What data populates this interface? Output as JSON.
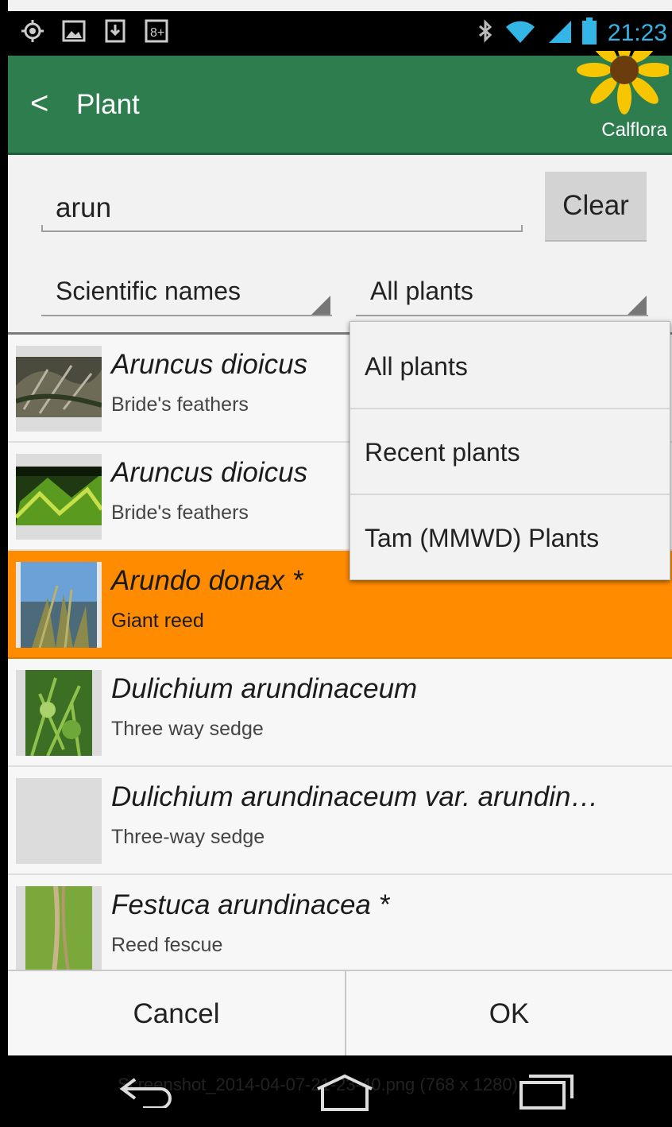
{
  "status_bar": {
    "time": "21:23",
    "colors": {
      "time": "#33b5e5"
    },
    "icons": [
      "gps-icon",
      "image-icon",
      "download-icon",
      "google-plus-icon",
      "bluetooth-icon",
      "wifi-icon",
      "signal-icon",
      "battery-icon"
    ]
  },
  "action_bar": {
    "back_glyph": "<",
    "title": "Plant",
    "brand": "Calflora",
    "color": "#2e7d4f"
  },
  "search": {
    "value": "arun",
    "clear_label": "Clear"
  },
  "filters": {
    "name_type": "Scientific names",
    "plant_set": "All plants"
  },
  "dropdown": {
    "options": [
      "All plants",
      "Recent plants",
      "Tam (MMWD) Plants"
    ]
  },
  "results": [
    {
      "sci": "Aruncus dioicus",
      "common": "Bride's feathers",
      "selected": false
    },
    {
      "sci": "Aruncus dioicus",
      "common": "Bride's feathers",
      "selected": false
    },
    {
      "sci": "Arundo donax *",
      "common": "Giant reed",
      "selected": true
    },
    {
      "sci": "Dulichium arundinaceum",
      "common": "Three way sedge",
      "selected": false
    },
    {
      "sci": "Dulichium arundinaceum var. arundin…",
      "common": "Three-way sedge",
      "selected": false
    },
    {
      "sci": "Festuca arundinacea *",
      "common": "Reed fescue",
      "selected": false
    }
  ],
  "buttons": {
    "cancel": "Cancel",
    "ok": "OK"
  },
  "nav_bar": {
    "caption": "Screenshot_2014-04-07-21-23-40.png (768 x 1280)",
    "icons": [
      "back-icon",
      "home-icon",
      "recents-icon"
    ]
  },
  "colors": {
    "selected_row": "#ff8c00"
  }
}
